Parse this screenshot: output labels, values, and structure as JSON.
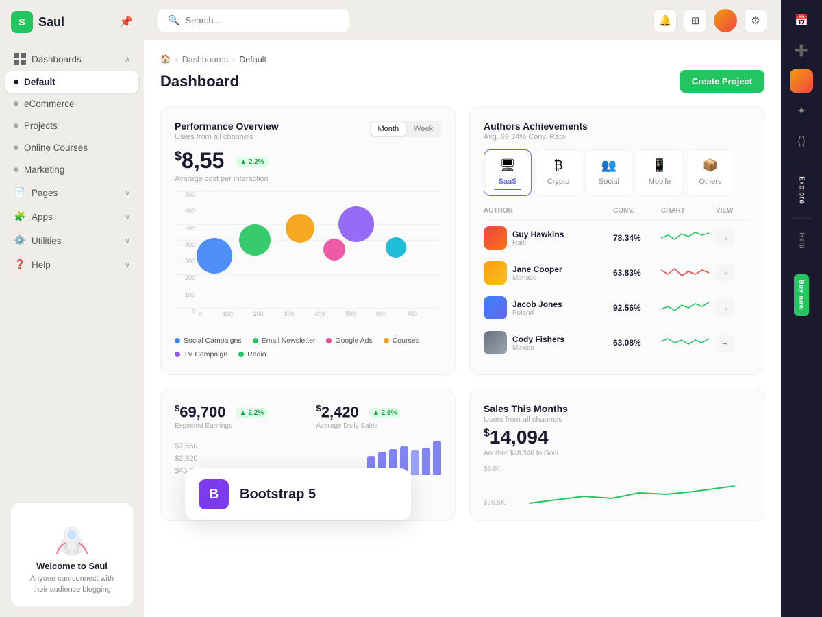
{
  "sidebar": {
    "logo_letter": "S",
    "app_name": "Saul",
    "nav_items": [
      {
        "id": "dashboards",
        "label": "Dashboards",
        "type": "section",
        "has_chevron": true
      },
      {
        "id": "default",
        "label": "Default",
        "type": "sub",
        "active": true
      },
      {
        "id": "ecommerce",
        "label": "eCommerce",
        "type": "sub"
      },
      {
        "id": "projects",
        "label": "Projects",
        "type": "sub"
      },
      {
        "id": "online-courses",
        "label": "Online Courses",
        "type": "sub"
      },
      {
        "id": "marketing",
        "label": "Marketing",
        "type": "sub"
      },
      {
        "id": "pages",
        "label": "Pages",
        "type": "section",
        "has_chevron": true
      },
      {
        "id": "apps",
        "label": "Apps",
        "type": "section",
        "has_chevron": true
      },
      {
        "id": "utilities",
        "label": "Utilities",
        "type": "section",
        "has_chevron": true
      },
      {
        "id": "help",
        "label": "Help",
        "type": "section",
        "has_chevron": true
      }
    ],
    "welcome_title": "Welcome to Saul",
    "welcome_text": "Anyone can connect with their audience blogging"
  },
  "topbar": {
    "search_placeholder": "Search...",
    "create_btn": "Create Project"
  },
  "breadcrumb": {
    "home": "🏠",
    "dashboards": "Dashboards",
    "current": "Default"
  },
  "page_title": "Dashboard",
  "performance": {
    "title": "Performance Overview",
    "subtitle": "Users from all channels",
    "toggle": {
      "month": "Month",
      "week": "Week"
    },
    "value": "$8,55",
    "value_dollar": "$",
    "value_number": "8,55",
    "badge": "▲ 2.2%",
    "value_label": "Avarage cost per interaction",
    "y_labels": [
      "700",
      "600",
      "500",
      "400",
      "300",
      "200",
      "100",
      "0"
    ],
    "x_labels": [
      "0",
      "100",
      "200",
      "300",
      "400",
      "500",
      "600",
      "700"
    ],
    "bubbles": [
      {
        "x": 15,
        "y": 55,
        "size": 52,
        "color": "#3b82f6"
      },
      {
        "x": 30,
        "y": 45,
        "size": 44,
        "color": "#22c55e"
      },
      {
        "x": 47,
        "y": 38,
        "size": 40,
        "color": "#f59e0b"
      },
      {
        "x": 60,
        "y": 50,
        "size": 30,
        "color": "#ec4899"
      },
      {
        "x": 70,
        "y": 40,
        "size": 50,
        "color": "#8b5cf6"
      },
      {
        "x": 83,
        "y": 52,
        "size": 28,
        "color": "#06b6d4"
      }
    ],
    "legend": [
      {
        "label": "Social Campaigns",
        "color": "#3b82f6"
      },
      {
        "label": "Email Newsletter",
        "color": "#22c55e"
      },
      {
        "label": "Google Ads",
        "color": "#ec4899"
      },
      {
        "label": "Courses",
        "color": "#f59e0b"
      },
      {
        "label": "TV Campaign",
        "color": "#8b5cf6"
      },
      {
        "label": "Radio",
        "color": "#22c55e"
      }
    ]
  },
  "authors": {
    "title": "Authors Achievements",
    "subtitle": "Avg. 69.34% Conv. Rate",
    "tabs": [
      {
        "id": "saas",
        "label": "SaaS",
        "icon": "🖥",
        "active": true
      },
      {
        "id": "crypto",
        "label": "Crypto",
        "icon": "₿"
      },
      {
        "id": "social",
        "label": "Social",
        "icon": "👥"
      },
      {
        "id": "mobile",
        "label": "Mobile",
        "icon": "📱"
      },
      {
        "id": "others",
        "label": "Others",
        "icon": "📦"
      }
    ],
    "columns": [
      "AUTHOR",
      "CONV.",
      "CHART",
      "VIEW"
    ],
    "rows": [
      {
        "name": "Guy Hawkins",
        "country": "Haiti",
        "conv": "78.34%",
        "chart_color": "#22c55e",
        "avatar_class": "av1"
      },
      {
        "name": "Jane Cooper",
        "country": "Monaco",
        "conv": "63.83%",
        "chart_color": "#ef4444",
        "avatar_class": "av2"
      },
      {
        "name": "Jacob Jones",
        "country": "Poland",
        "conv": "92.56%",
        "chart_color": "#22c55e",
        "avatar_class": "av3"
      },
      {
        "name": "Cody Fishers",
        "country": "Mexico",
        "conv": "63.08%",
        "chart_color": "#22c55e",
        "avatar_class": "av4"
      }
    ]
  },
  "earnings": {
    "value1_dollar": "$",
    "value1": "69,700",
    "badge1": "▲ 2.2%",
    "label1": "Expected Earnings",
    "value2_dollar": "$",
    "value2": "2,420",
    "badge2": "▲ 2.6%",
    "label2": "Average Daily Sales",
    "rows": [
      "$7,660",
      "$2,820",
      "$45,257"
    ],
    "bars": [
      30,
      36,
      40,
      44,
      38,
      42,
      50
    ]
  },
  "sales": {
    "title": "Sales This Months",
    "subtitle": "Users from all channels",
    "value_dollar": "$",
    "value": "14,094",
    "goal_text": "Another $48,346 to Goal",
    "y_labels": [
      "$24K",
      "$20.5K"
    ]
  },
  "bootstrap_overlay": {
    "letter": "B",
    "title": "Bootstrap 5"
  },
  "right_panel": {
    "icons": [
      "📅",
      "➕",
      "🔮",
      "💻"
    ],
    "labels": [
      "Explore",
      "Help",
      "Buy now"
    ]
  }
}
